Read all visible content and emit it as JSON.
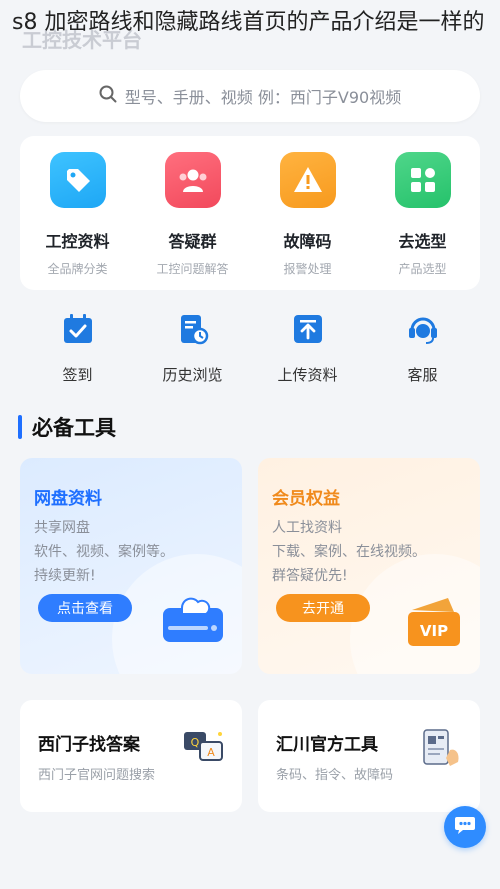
{
  "caption": "s8 加密路线和隐藏路线首页的产品介绍是一样的",
  "ghost_title": "工控技术平台",
  "search": {
    "placeholder": "型号、手册、视频 例：西门子V90视频",
    "icon": "search-icon"
  },
  "quick_nav": [
    {
      "label": "工控资料",
      "sub": "全品牌分类",
      "icon": "tag-icon",
      "color": "#1ea7f5"
    },
    {
      "label": "答疑群",
      "sub": "工控问题解答",
      "icon": "group-icon",
      "color": "#f2495c"
    },
    {
      "label": "故障码",
      "sub": "报警处理",
      "icon": "warning-icon",
      "color": "#f79a1e"
    },
    {
      "label": "去选型",
      "sub": "产品选型",
      "icon": "grid-icon",
      "color": "#25c26b"
    }
  ],
  "tools": [
    {
      "label": "签到",
      "icon": "calendar-check-icon"
    },
    {
      "label": "历史浏览",
      "icon": "history-icon"
    },
    {
      "label": "上传资料",
      "icon": "upload-icon"
    },
    {
      "label": "客服",
      "icon": "headset-icon"
    }
  ],
  "section": {
    "title": "必备工具"
  },
  "promos": [
    {
      "title": "网盘资料",
      "lines": [
        "共享网盘",
        "软件、视频、案例等。",
        "持续更新!"
      ],
      "button": "点击查看",
      "title_color": "#1e6fff",
      "button_color": "#2f7dff"
    },
    {
      "title": "会员权益",
      "lines": [
        "人工找资料",
        "下载、案例、在线视频。",
        "群答疑优先!"
      ],
      "button": "去开通",
      "title_color": "#f08a1c",
      "button_color": "#f7931e"
    }
  ],
  "bottom_cards": [
    {
      "title": "西门子找答案",
      "sub": "西门子官网问题搜索"
    },
    {
      "title": "汇川官方工具",
      "sub": "条码、指令、故障码"
    }
  ],
  "vip_badge": "VIP"
}
